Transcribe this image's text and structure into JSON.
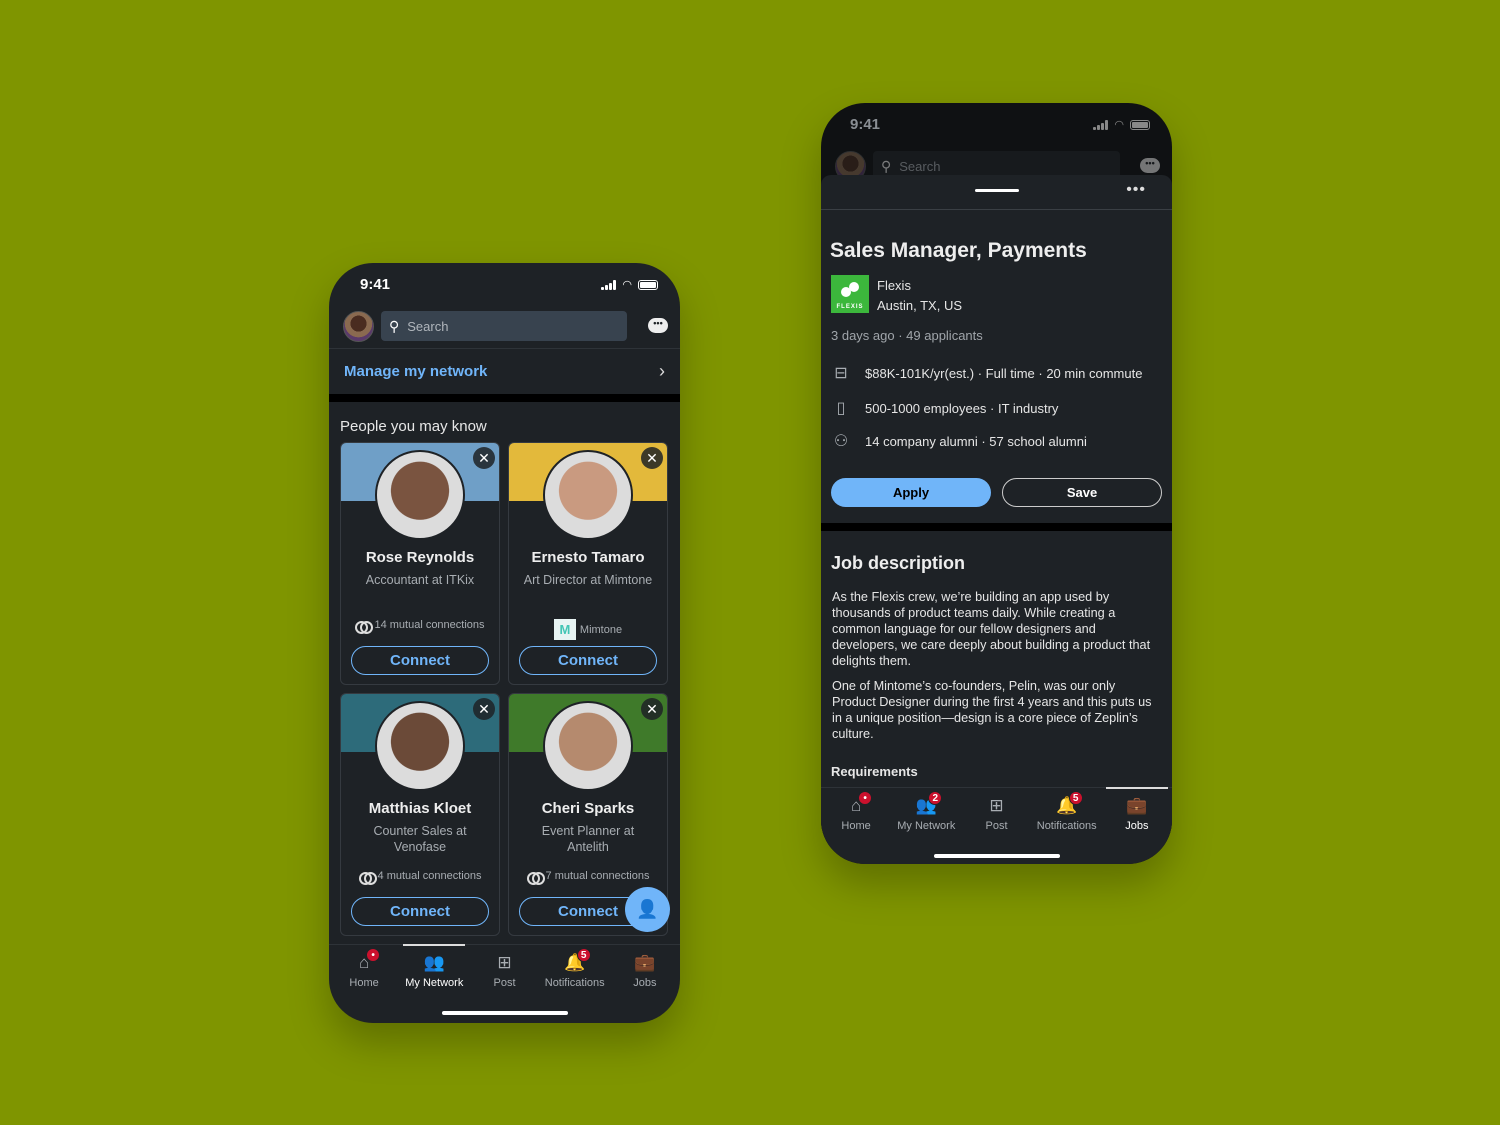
{
  "left_phone": {
    "status": {
      "time": "9:41"
    },
    "search": {
      "placeholder": "Search"
    },
    "manage_network": {
      "label": "Manage my network",
      "chevron": "›"
    },
    "pymk_title": "People you may know",
    "people": [
      {
        "name": "Rose Reynolds",
        "headline": "Accountant at ITKix",
        "insight": "14 mutual connections",
        "insight_type": "mutual",
        "connect": "Connect",
        "banner": "#6f9fc7",
        "photo": "#7a5440"
      },
      {
        "name": "Ernesto Tamaro",
        "headline": "Art Director at Mimtone",
        "insight": "Mimtone",
        "insight_type": "company",
        "connect": "Connect",
        "banner": "#e3b93b",
        "photo": "#c99a80"
      },
      {
        "name": "Matthias Kloet",
        "headline": "Counter Sales at Venofase",
        "insight": "4 mutual connections",
        "insight_type": "mutual",
        "connect": "Connect",
        "banner": "#2d6b7a",
        "photo": "#6b4a38"
      },
      {
        "name": "Cheri Sparks",
        "headline": "Event Planner at Antelith",
        "insight": "7 mutual connections",
        "insight_type": "mutual",
        "connect": "Connect",
        "banner": "#3f7a2a",
        "photo": "#b58a6e"
      }
    ],
    "close_glyph": "✕",
    "company_logo_letter": "M",
    "tabs": [
      {
        "label": "Home",
        "icon": "⌂",
        "badge": "•"
      },
      {
        "label": "My Network",
        "icon": "👥",
        "badge": null,
        "active": true
      },
      {
        "label": "Post",
        "icon": "⊞",
        "badge": null
      },
      {
        "label": "Notifications",
        "icon": "🔔",
        "badge": "5"
      },
      {
        "label": "Jobs",
        "icon": "💼",
        "badge": null
      }
    ]
  },
  "right_phone": {
    "status": {
      "time": "9:41"
    },
    "search": {
      "placeholder": "Search"
    },
    "more_glyph": "•••",
    "job": {
      "title": "Sales Manager, Payments",
      "company": "Flexis",
      "company_logo_text": "FLEXIS",
      "location": "Austin, TX, US",
      "posted": "3 days ago · 49 applicants",
      "details": [
        {
          "icon": "briefcase-icon",
          "text": "$88K-101K/yr(est.) · Full time · 20 min commute"
        },
        {
          "icon": "building-icon",
          "text": "500-1000 employees · IT industry"
        },
        {
          "icon": "people-icon",
          "text": "14 company alumni · 57 school alumni"
        }
      ],
      "apply": "Apply",
      "save": "Save"
    },
    "description": {
      "title": "Job description",
      "paragraphs": [
        "As the Flexis crew, we’re building an app used by thousands of product teams daily. While creating a common language for our fellow designers and developers, we care deeply about building a product that delights them.",
        "One of Mintome’s co-founders, Pelin, was our only Product Designer during the first 4 years and this puts us in a unique position—design is a core piece of Zeplin’s culture."
      ],
      "requirements": "Requirements"
    },
    "tabs": [
      {
        "label": "Home",
        "icon": "⌂",
        "badge": "•"
      },
      {
        "label": "My Network",
        "icon": "👥",
        "badge": "2"
      },
      {
        "label": "Post",
        "icon": "⊞",
        "badge": null
      },
      {
        "label": "Notifications",
        "icon": "🔔",
        "badge": "5"
      },
      {
        "label": "Jobs",
        "icon": "💼",
        "badge": null,
        "active": true
      }
    ]
  },
  "colors": {
    "background": "#7f9500",
    "accent": "#70b5f9",
    "badge": "#cb112d",
    "surface": "#1e2226"
  }
}
